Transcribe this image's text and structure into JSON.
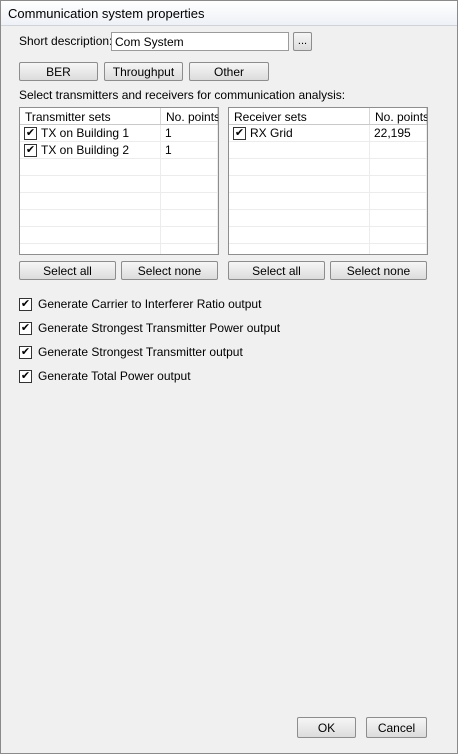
{
  "window": {
    "title": "Communication system properties"
  },
  "description": {
    "label": "Short description:",
    "value": "Com System",
    "browse_label": "..."
  },
  "tabs": {
    "ber": "BER",
    "throughput": "Throughput",
    "other": "Other"
  },
  "select_label": "Select transmitters and receivers for communication analysis:",
  "transmitters": {
    "col_name": "Transmitter sets",
    "col_points": "No. points",
    "rows": [
      {
        "name": "TX on Building 1",
        "points": "1",
        "checked": true
      },
      {
        "name": "TX on Building 2",
        "points": "1",
        "checked": true
      }
    ],
    "select_all": "Select all",
    "select_none": "Select none"
  },
  "receivers": {
    "col_name": "Receiver sets",
    "col_points": "No. points",
    "rows": [
      {
        "name": "RX Grid",
        "points": "22,195",
        "checked": true
      }
    ],
    "select_all": "Select all",
    "select_none": "Select none"
  },
  "outputs": [
    {
      "label": "Generate Carrier to Interferer Ratio output",
      "checked": true
    },
    {
      "label": "Generate Strongest Transmitter Power output",
      "checked": true
    },
    {
      "label": "Generate Strongest Transmitter output",
      "checked": true
    },
    {
      "label": "Generate Total Power output",
      "checked": true
    }
  ],
  "footer": {
    "ok": "OK",
    "cancel": "Cancel"
  }
}
